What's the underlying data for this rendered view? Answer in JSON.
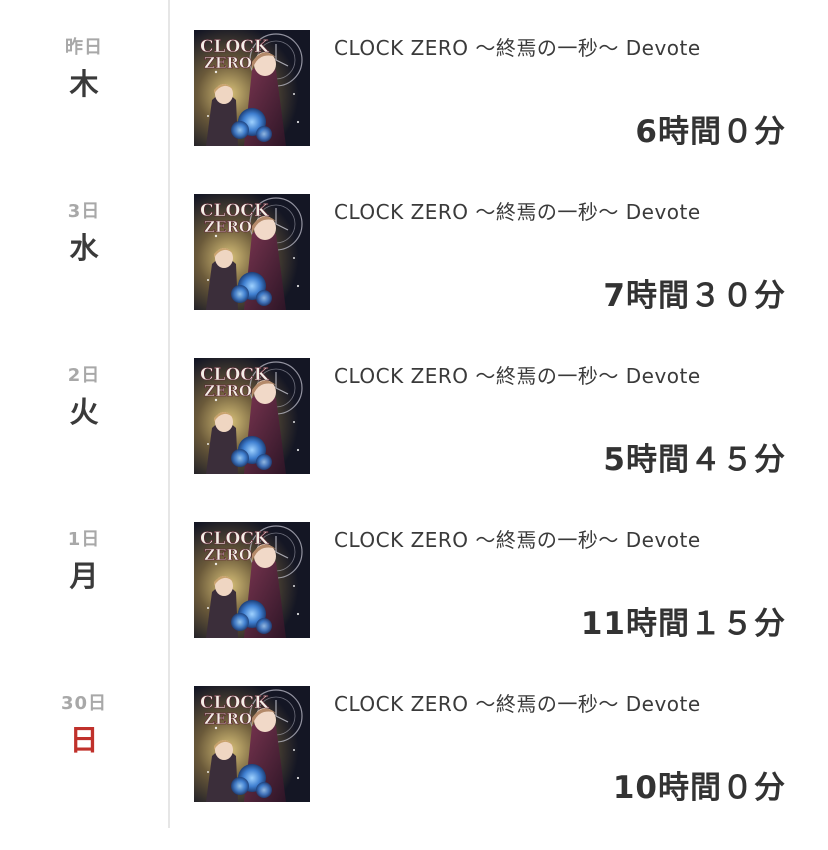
{
  "entries": [
    {
      "date_sub": "昨日",
      "weekday": "木",
      "is_sunday": false,
      "game_title": "CLOCK ZERO 〜終焉の一秒〜 Devote",
      "duration": "6時間０分"
    },
    {
      "date_sub": "3日",
      "weekday": "水",
      "is_sunday": false,
      "game_title": "CLOCK ZERO 〜終焉の一秒〜 Devote",
      "duration": "7時間３０分"
    },
    {
      "date_sub": "2日",
      "weekday": "火",
      "is_sunday": false,
      "game_title": "CLOCK ZERO 〜終焉の一秒〜 Devote",
      "duration": "5時間４５分"
    },
    {
      "date_sub": "1日",
      "weekday": "月",
      "is_sunday": false,
      "game_title": "CLOCK ZERO 〜終焉の一秒〜 Devote",
      "duration": "11時間１５分"
    },
    {
      "date_sub": "30日",
      "weekday": "日",
      "is_sunday": true,
      "game_title": "CLOCK ZERO 〜終焉の一秒〜 Devote",
      "duration": "10時間０分"
    }
  ],
  "colors": {
    "sunday": "#c0312b",
    "text": "#333333",
    "date_sub": "#a8a8a8",
    "divider": "#e6e6e6"
  },
  "icons": {
    "cover": "game-cover-art-image"
  }
}
